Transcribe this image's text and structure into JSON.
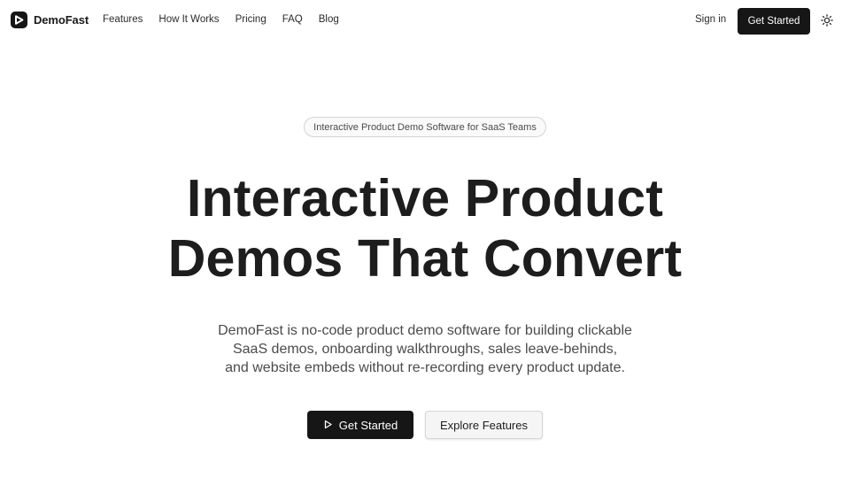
{
  "nav": {
    "brand": "DemoFast",
    "brand_icon": "play-logo-icon",
    "links": [
      "Features",
      "How It Works",
      "Pricing",
      "FAQ",
      "Blog"
    ],
    "sign_in": "Sign in",
    "cta": "Get Started",
    "theme_icon": "sun-icon"
  },
  "hero": {
    "badge": "Interactive Product Demo Software for SaaS Teams",
    "headline": [
      "Interactive Product",
      "Demos That Convert"
    ],
    "subcopy": [
      "DemoFast is no-code product demo software for building clickable",
      "SaaS demos, onboarding walkthroughs, sales leave-behinds,",
      "and website embeds without re-recording every product update."
    ],
    "primary_cta": "Get Started",
    "primary_cta_icon": "play-icon",
    "secondary_cta": "Explore Features"
  },
  "colors": {
    "primary_button": "#161616",
    "text": "#1c1c1c",
    "muted_text": "#4b4b4b",
    "background": "#ffffff"
  }
}
